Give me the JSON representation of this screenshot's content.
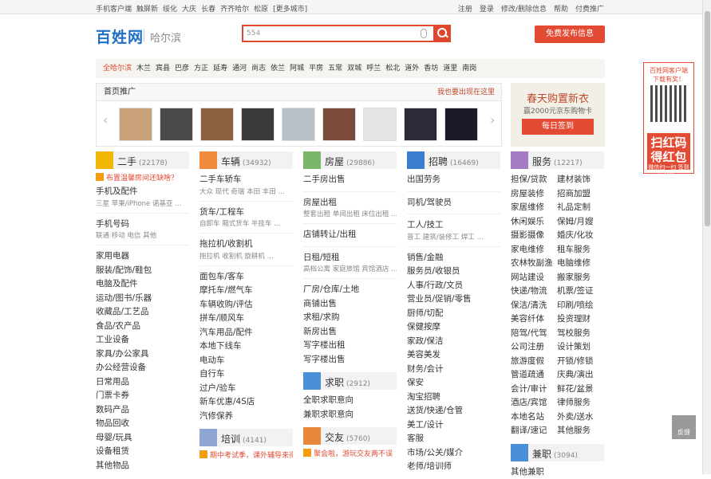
{
  "topbar": {
    "left": [
      "手机客户端",
      "触屏新",
      "绥化",
      "大庆",
      "长春",
      "齐齐哈尔",
      "松原",
      "[更多城市]"
    ],
    "right": [
      "注册",
      "登录",
      "修改/删除信息",
      "帮助",
      "付费推广"
    ]
  },
  "header": {
    "logo": "百姓网",
    "city": "哈尔滨",
    "search_value": "554",
    "post_button": "免费发布信息"
  },
  "cities": [
    "全哈尔滨",
    "木兰",
    "宾县",
    "巴彦",
    "方正",
    "延寿",
    "通河",
    "尚志",
    "依兰",
    "阿城",
    "平房",
    "五常",
    "双城",
    "呼兰",
    "松北",
    "道外",
    "香坊",
    "道里",
    "南岗"
  ],
  "promo": {
    "title": "首页推广",
    "link": "我也要出现在这里"
  },
  "side_ad": {
    "title": "春天购置新衣",
    "sub": "赢2000元京东购物卡",
    "button": "每日签到"
  },
  "qr": {
    "title": "百姓网客户端",
    "sub": "下载有奖！",
    "big": "扫红码得红包",
    "small": "微信扫一扫 签到送100元"
  },
  "feedback": "反馈",
  "colors": {
    "accent": "#e34a33",
    "brand": "#1e6fc5"
  },
  "col1": {
    "name": "二手",
    "count": "(22178)",
    "notice": "布置温馨房间还缺啥？",
    "groups": [
      {
        "title": "手机及配件",
        "sub": "三星 苹果/iPhone 诺基亚 ..."
      },
      {
        "title": "手机号码",
        "sub": "联通 移动 电信 其他"
      }
    ],
    "items": [
      "家用电器",
      "服装/配饰/鞋包",
      "电脑及配件",
      "运动/图书/乐器",
      "收藏品/工艺品",
      "食品/农产品",
      "工业设备",
      "家具/办公家具",
      "办公经营设备",
      "日常用品",
      "门票卡券",
      "数码产品",
      "物品回收",
      "母婴/玩具",
      "设备租赁",
      "其他物品"
    ]
  },
  "col2": {
    "name": "车辆",
    "count": "(34932)",
    "groups": [
      {
        "title": "二手车轿车",
        "sub": "大众 现代 奇瑞 本田 丰田 ..."
      },
      {
        "title": "货车/工程车",
        "sub": "自卸车 厢式货车 半挂车 ..."
      },
      {
        "title": "拖拉机/收割机",
        "sub": "拖拉机 收割机 旋耕机 ..."
      }
    ],
    "items": [
      "面包车/客车",
      "摩托车/燃气车",
      "车辆收购/评估",
      "拼车/顺风车",
      "汽车用品/配件",
      "本地下线车",
      "电动车",
      "自行车",
      "过户/验车",
      "新车优惠/4S店",
      "汽修保养"
    ],
    "next": {
      "name": "培训",
      "count": "(4141)",
      "notice": "期中考试季，课外辅导来得及"
    }
  },
  "col3": {
    "name": "房屋",
    "count": "(29886)",
    "groups": [
      {
        "title": "二手房出售",
        "sub": ""
      },
      {
        "title": "房屋出租",
        "sub": "整套出租 单间出租 床位出租 ..."
      },
      {
        "title": "店铺转让/出租",
        "sub": ""
      },
      {
        "title": "日租/短租",
        "sub": "高档公寓 家庭旅馆 宾馆酒店 ..."
      }
    ],
    "items": [
      "厂房/仓库/土地",
      "商铺出售",
      "求租/求购",
      "新房出售",
      "写字楼出租",
      "写字楼出售"
    ],
    "next": {
      "name": "求职",
      "count": "(2912)",
      "items": [
        "全职求职意向",
        "兼职求职意向"
      ]
    },
    "next2": {
      "name": "交友",
      "count": "(5760)",
      "notice": "聚会啦，游玩交友两不误"
    }
  },
  "col4": {
    "name": "招聘",
    "count": "(16469)",
    "groups": [
      {
        "title": "出国劳务",
        "sub": ""
      },
      {
        "title": "司机/驾驶员",
        "sub": ""
      },
      {
        "title": "工人/技工",
        "sub": "普工 建筑/装修工 焊工 ..."
      }
    ],
    "items": [
      "销售/金融",
      "服务员/收银员",
      "人事/行政/文员",
      "营业员/促销/零售",
      "厨师/切配",
      "保健按摩",
      "家政/保洁",
      "美容美发",
      "财务/会计",
      "保安",
      "淘宝招聘",
      "送货/快递/仓管",
      "美工/设计",
      "客服",
      "市场/公关/媒介",
      "老师/培训师"
    ]
  },
  "col5": {
    "name": "服务",
    "count": "(12217)",
    "pairs": [
      [
        "担保/贷款",
        "建材装饰"
      ],
      [
        "房屋装修",
        "招商加盟"
      ],
      [
        "家居维修",
        "礼品定制"
      ],
      [
        "休闲娱乐",
        "保姆/月嫂"
      ],
      [
        "摄影摄像",
        "婚庆/化妆"
      ],
      [
        "家电维修",
        "租车服务"
      ],
      [
        "农林牧副渔",
        "电脑维修"
      ],
      [
        "网站建设",
        "搬家服务"
      ],
      [
        "快递/物流",
        "机票/签证"
      ],
      [
        "保洁/清洗",
        "印刷/喷绘"
      ],
      [
        "美容纤体",
        "投资理财"
      ],
      [
        "陪驾/代驾",
        "驾校服务"
      ],
      [
        "公司注册",
        "设计策划"
      ],
      [
        "旅游度假",
        "开锁/修锁"
      ],
      [
        "管道疏通",
        "庆典/演出"
      ],
      [
        "会计/审计",
        "鲜花/盆景"
      ],
      [
        "酒店/宾馆",
        "律师服务"
      ],
      [
        "本地名站",
        "外卖/送水"
      ],
      [
        "翻译/速记",
        "其他服务"
      ]
    ],
    "next": {
      "name": "兼职",
      "count": "(3094)",
      "items": [
        "其他兼职"
      ]
    }
  }
}
